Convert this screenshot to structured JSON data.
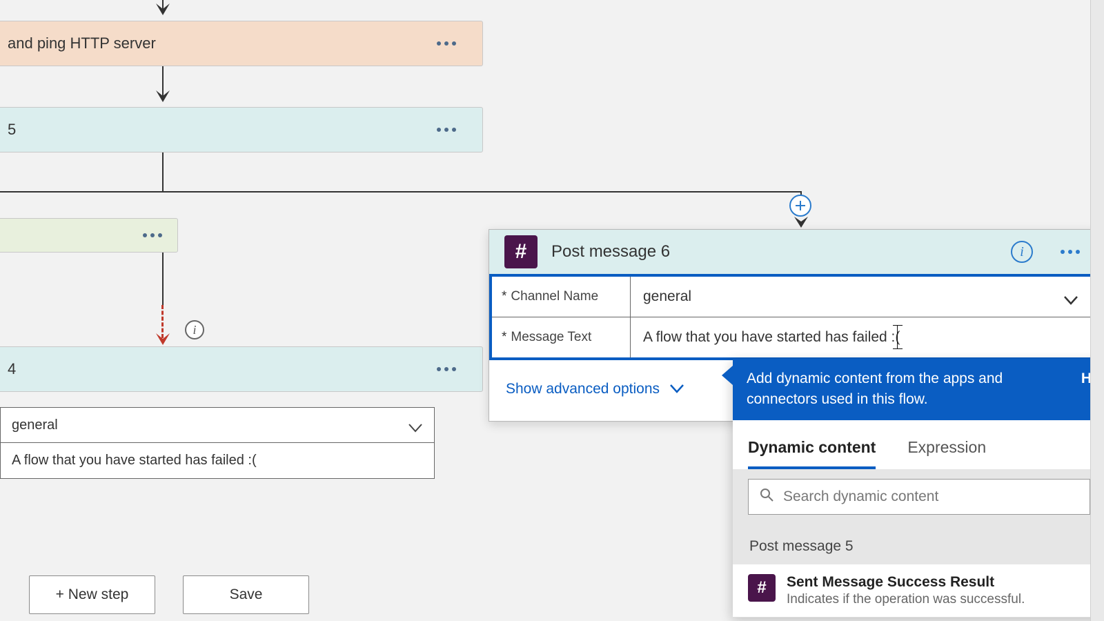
{
  "flow": {
    "card_http_label": "and ping HTTP server",
    "card_5_label": "5",
    "card_4_label": "4"
  },
  "left_form": {
    "channel_value": "general",
    "message_value": "A flow that you have started has failed :("
  },
  "footer": {
    "new_step_label": "+ New step",
    "save_label": "Save"
  },
  "action": {
    "title": "Post message 6",
    "channel_label": "Channel Name",
    "channel_value": "general",
    "message_label": "Message Text",
    "message_value": "A flow that you have started has failed :(",
    "advanced_label": "Show advanced options"
  },
  "dynamic": {
    "tip": "Add dynamic content from the apps and connectors used in this flow.",
    "tip_right": "H",
    "tab_dynamic": "Dynamic content",
    "tab_expression": "Expression",
    "search_placeholder": "Search dynamic content",
    "group0": "Post message 5",
    "item0_title": "Sent Message Success Result",
    "item0_desc": "Indicates if the operation was successful."
  }
}
